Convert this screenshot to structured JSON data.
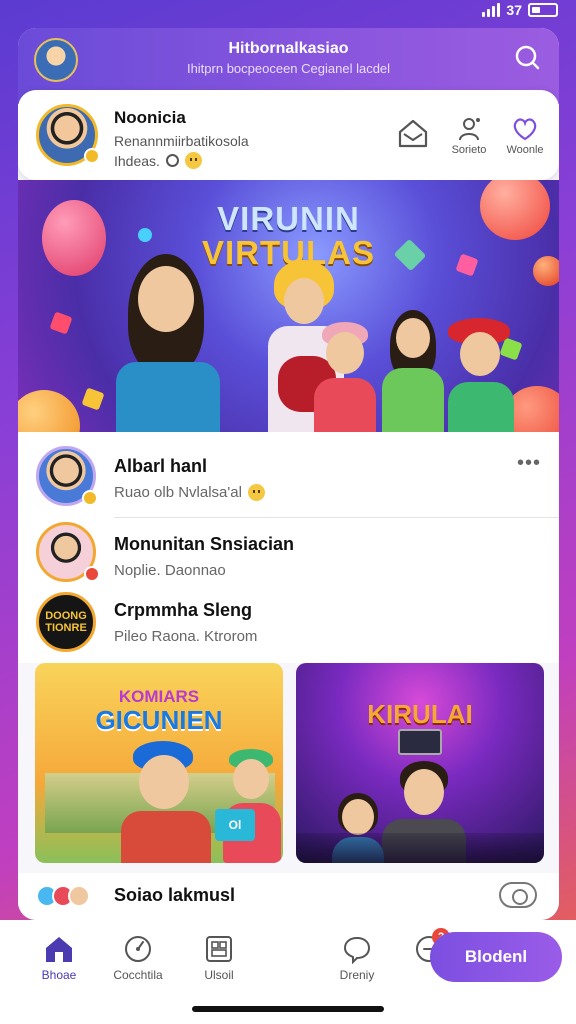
{
  "status_bar": {
    "signal_text": "37"
  },
  "header": {
    "title": "Hitbornalkasiao",
    "subtitle": "Ihitprn bocpeoceen Cegianel lacdel"
  },
  "profile": {
    "name": "Noonicia",
    "line1": "Renannmiirbatikosola",
    "line2": "Ihdeas.",
    "actions": [
      {
        "label": "",
        "icon": "home-mail-icon"
      },
      {
        "label": "Sorieto",
        "icon": "people-icon"
      },
      {
        "label": "Woonle",
        "icon": "heart-icon"
      }
    ]
  },
  "hero": {
    "title_line1": "VIRUNIN",
    "title_line2": "VIRTULAS"
  },
  "feed": [
    {
      "title": "Albarl hanl",
      "subtitle": "Ruao olb Nvlalsa'al"
    },
    {
      "title": "Monunitan Snsiacian",
      "subtitle": "Noplie. Daonnao"
    },
    {
      "title": "Crpmmha Sleng",
      "subtitle": "Pileo Raona. Ktrorom",
      "logo_text": "DOONG TIONRE"
    }
  ],
  "tiles": [
    {
      "title_top": "KOMIARS",
      "title_main": "GICUNIEN",
      "card_text": "Ol"
    },
    {
      "title_main": "KIRULAI"
    }
  ],
  "strip": {
    "label": "Soiao lakmusl"
  },
  "nav": {
    "items": [
      {
        "label": "Bhoae",
        "icon": "home-icon",
        "active": true
      },
      {
        "label": "Cocchtila",
        "icon": "compass-icon",
        "active": false
      },
      {
        "label": "Ulsoil",
        "icon": "grid-icon",
        "active": false
      },
      {
        "label": "Dreniy",
        "icon": "chat-icon",
        "active": false
      },
      {
        "label": "",
        "icon": "notification-icon",
        "active": false,
        "badge": "2"
      }
    ],
    "cta_label": "Blodenl"
  },
  "colors": {
    "accent": "#7c4fe0",
    "badge_red": "#e8473a",
    "gold": "#f2b928"
  }
}
